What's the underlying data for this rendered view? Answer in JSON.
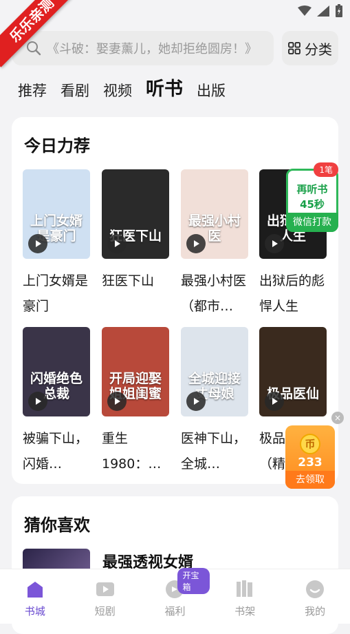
{
  "ribbon": "乐乐亲测",
  "search": {
    "placeholder": "《斗破：娶妻薰儿，她却拒绝圆房！》"
  },
  "category_button": "分类",
  "tabs": [
    {
      "label": "推荐",
      "active": false
    },
    {
      "label": "看剧",
      "active": false
    },
    {
      "label": "视频",
      "active": false
    },
    {
      "label": "听书",
      "active": true
    },
    {
      "label": "出版",
      "active": false
    }
  ],
  "today": {
    "title": "今日力荐",
    "books": [
      {
        "title": "上门女婿是豪门",
        "cover_text": "上门女婿是豪门",
        "bg": "#cfe0f2"
      },
      {
        "title": "狂医下山",
        "cover_text": "狂医下山",
        "bg": "#2a2a2a"
      },
      {
        "title": "最强小村医（都市…",
        "cover_text": "最强小村医",
        "bg": "#f1dfd8"
      },
      {
        "title": "出狱后的彪悍人生",
        "cover_text": "出狱后的人生",
        "bg": "#1c1c1c"
      },
      {
        "title": "被骗下山，闪婚…",
        "cover_text": "闪婚绝色总裁",
        "bg": "#3a3448"
      },
      {
        "title": "重生1980：…",
        "cover_text": "开局迎娶姐姐闺蜜",
        "bg": "#b8493a"
      },
      {
        "title": "医神下山，全城…",
        "cover_text": "全城迎接丈母娘",
        "bg": "#dde4ec"
      },
      {
        "title": "极品医仙（精…",
        "cover_text": "极品医仙",
        "bg": "#3a2a1e"
      }
    ]
  },
  "float_reward": {
    "badge": "1笔",
    "line1": "再听书",
    "line2": "45秒",
    "button": "微信打款"
  },
  "coin_widget": {
    "count": "233",
    "button": "去领取",
    "coin_symbol": "币",
    "close": "×"
  },
  "guess": {
    "title": "猜你喜欢",
    "first_book": "最强透视女婿"
  },
  "nav": [
    {
      "label": "书城",
      "icon": "bookstore-icon",
      "active": true
    },
    {
      "label": "短剧",
      "icon": "play-video-icon",
      "active": false
    },
    {
      "label": "福利",
      "icon": "gift-icon",
      "active": false,
      "badge": "开宝箱"
    },
    {
      "label": "书架",
      "icon": "bookshelf-icon",
      "active": false
    },
    {
      "label": "我的",
      "icon": "profile-icon",
      "active": false
    }
  ],
  "colors": {
    "accent": "#6a4bd0",
    "green": "#26b04f",
    "orange": "#ff8a1e"
  }
}
